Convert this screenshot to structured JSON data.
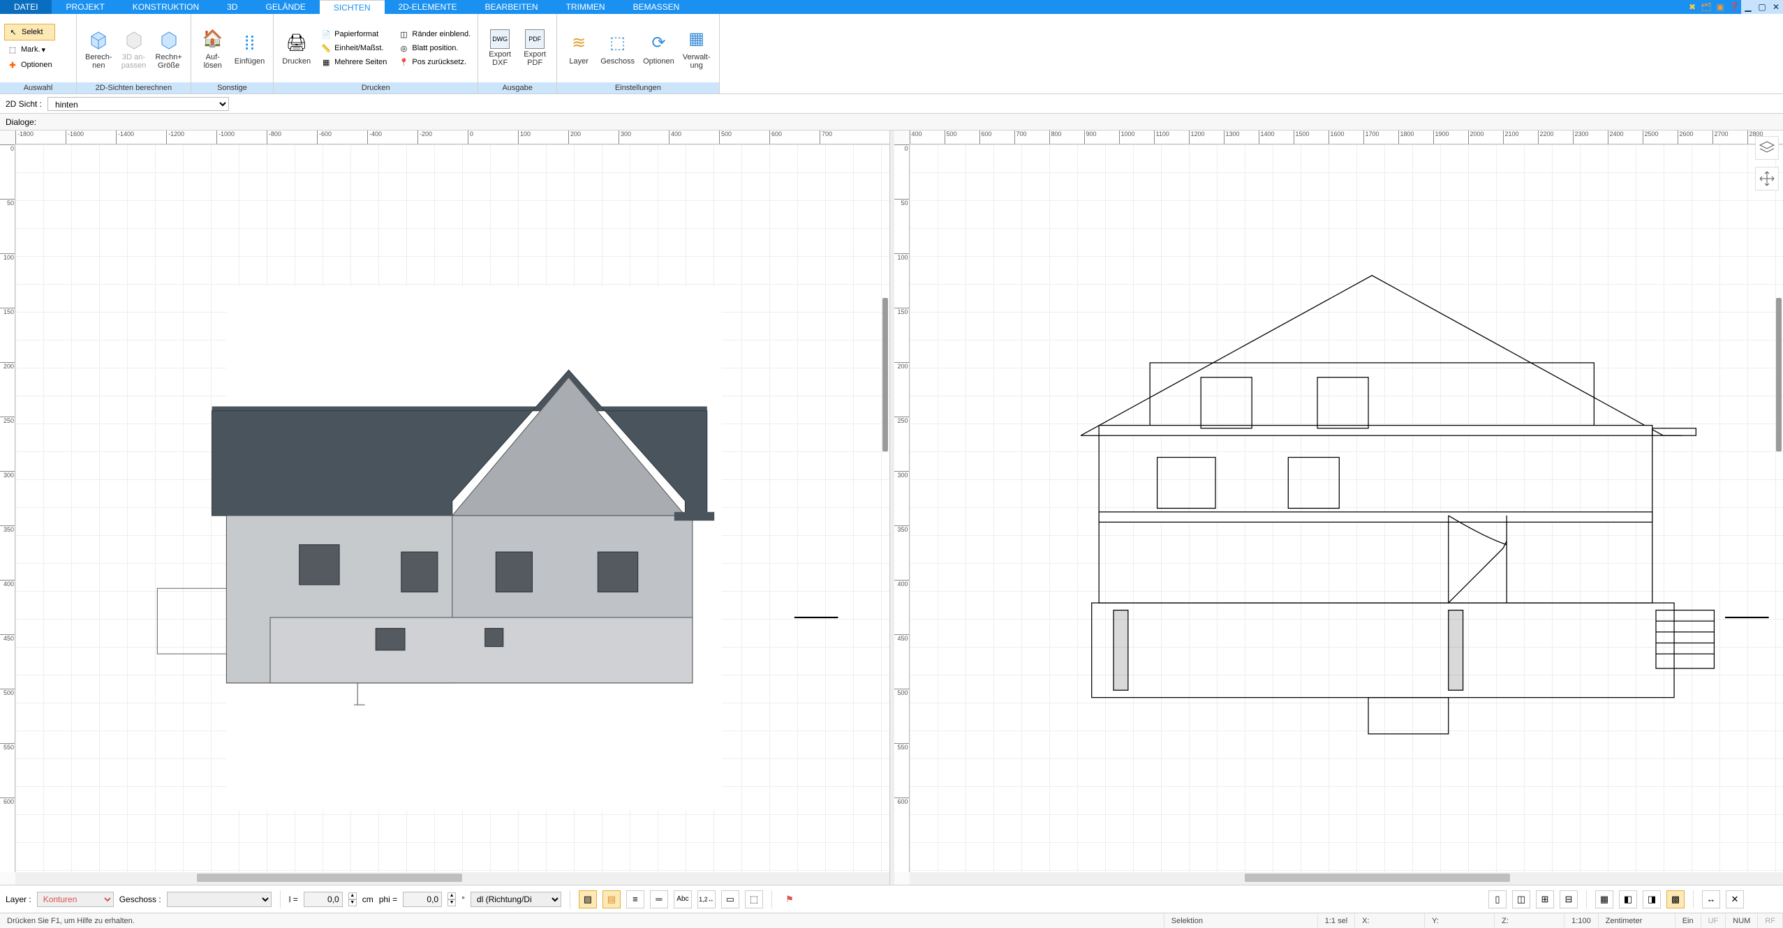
{
  "menu": {
    "tabs": [
      "DATEI",
      "PROJEKT",
      "KONSTRUKTION",
      "3D",
      "GELÄNDE",
      "SICHTEN",
      "2D-ELEMENTE",
      "BEARBEITEN",
      "TRIMMEN",
      "BEMASSEN"
    ],
    "active": "SICHTEN"
  },
  "ribbon": {
    "auswahl": {
      "label": "Auswahl",
      "selekt": "Selekt",
      "mark": "Mark.",
      "optionen": "Optionen"
    },
    "sichten": {
      "label": "2D-Sichten berechnen",
      "berechnen": "Berech-\nnen",
      "anpassen": "3D an-\npassen",
      "rechen": "Rechn+\nGröße"
    },
    "sonstige": {
      "label": "Sonstige",
      "aufloesen": "Auf-\nlösen",
      "einfuegen": "Einfügen"
    },
    "drucken": {
      "label": "Drucken",
      "drucken": "Drucken",
      "papierformat": "Papierformat",
      "einheit": "Einheit/Maßst.",
      "mehrere": "Mehrere Seiten",
      "raender": "Ränder einblend.",
      "blatt": "Blatt position.",
      "pos": "Pos zurücksetz."
    },
    "ausgabe": {
      "label": "Ausgabe",
      "dxf": "Export\nDXF",
      "pdf": "Export\nPDF"
    },
    "einstellungen": {
      "label": "Einstellungen",
      "layer": "Layer",
      "geschoss": "Geschoss",
      "optionen": "Optionen",
      "verwaltung": "Verwalt-\nung"
    }
  },
  "secbar": {
    "label": "2D Sicht :",
    "value": "hinten"
  },
  "dialogbar": {
    "label": "Dialoge:"
  },
  "rulers": {
    "left_h": [
      "-1800",
      "-1600",
      "-1400",
      "-1200",
      "-1000",
      "-800",
      "-600",
      "-400",
      "-200",
      "0",
      "100",
      "200",
      "300",
      "400",
      "500",
      "600",
      "700"
    ],
    "left_v": [
      "0",
      "50",
      "100",
      "150",
      "200",
      "250",
      "300",
      "350",
      "400",
      "450",
      "500",
      "550",
      "600"
    ],
    "right_h": [
      "400",
      "500",
      "600",
      "700",
      "800",
      "900",
      "1000",
      "1100",
      "1200",
      "1300",
      "1400",
      "1500",
      "1600",
      "1700",
      "1800",
      "1900",
      "2000",
      "2100",
      "2200",
      "2300",
      "2400",
      "2500",
      "2600",
      "2700",
      "2800"
    ],
    "right_v": [
      "0",
      "50",
      "100",
      "150",
      "200",
      "250",
      "300",
      "350",
      "400",
      "450",
      "500",
      "550",
      "600"
    ]
  },
  "bottombar": {
    "layer_label": "Layer :",
    "layer_value": "Konturen",
    "geschoss_label": "Geschoss :",
    "geschoss_value": "",
    "l_label": "l =",
    "l_value": "0,0",
    "l_unit": "cm",
    "phi_label": "phi =",
    "phi_value": "0,0",
    "phi_unit": "°",
    "mode": "dl (Richtung/Di"
  },
  "status": {
    "help": "Drücken Sie F1, um Hilfe zu erhalten.",
    "sel": "Selektion",
    "scale1": "1:1 sel",
    "x": "X:",
    "y": "Y:",
    "z": "Z:",
    "scale2": "1:100",
    "unit": "Zentimeter",
    "ein": "Ein",
    "uf": "UF",
    "num": "NUM",
    "rf": "RF"
  }
}
